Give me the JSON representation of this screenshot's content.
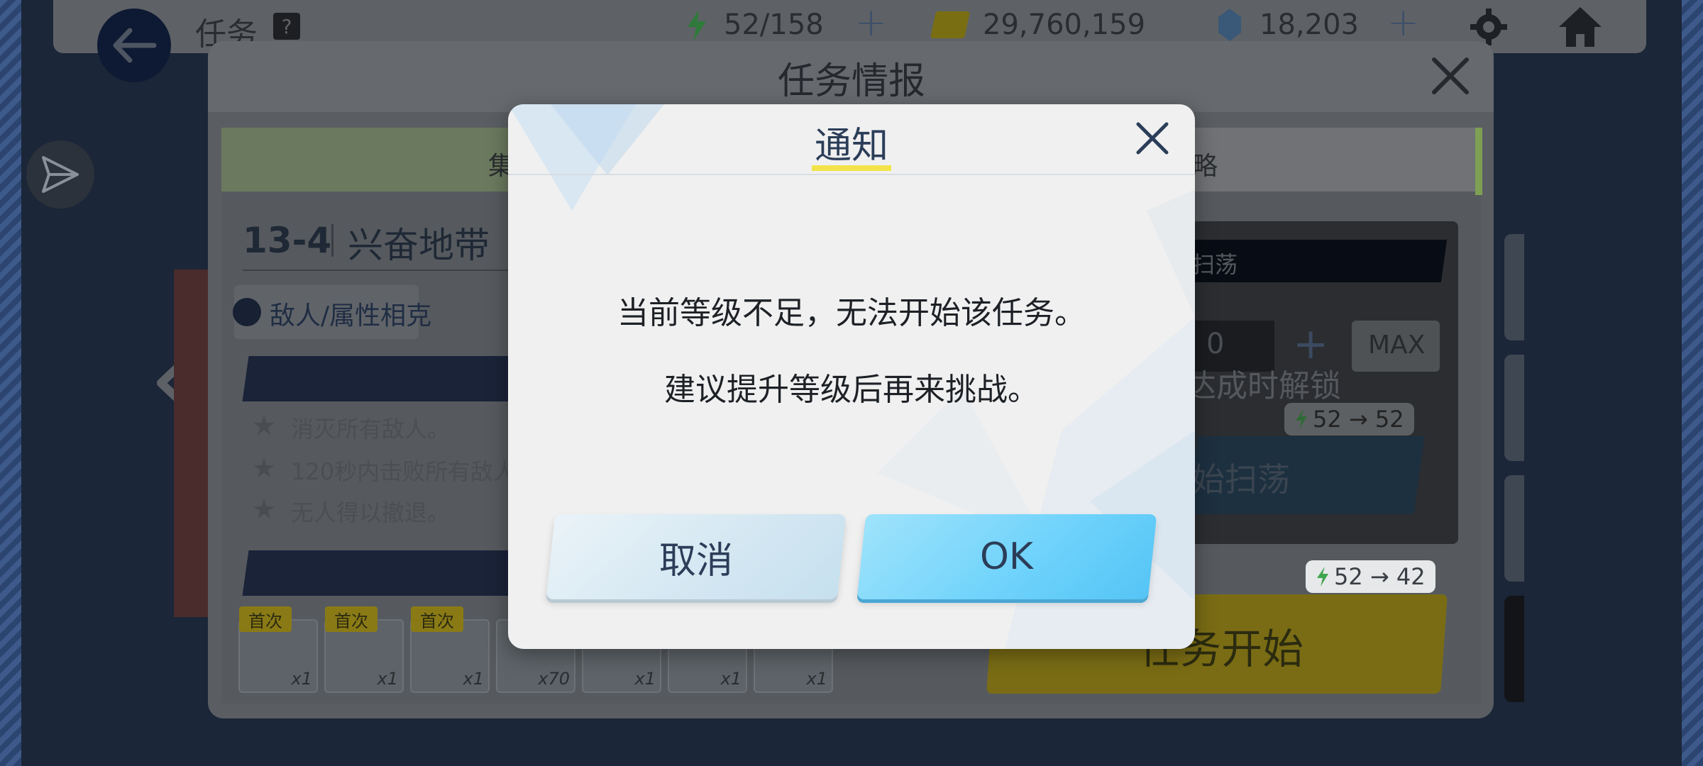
{
  "topbar": {
    "title": "任务",
    "help_badge": "?",
    "ap": "52/158",
    "credits": "29,760,159",
    "gems": "18,203"
  },
  "mission_panel": {
    "title": "任务情报",
    "tab_left_partial": "集",
    "tab_right_partial": "略",
    "stage_code": "13-4",
    "stage_name": "兴奋地带",
    "enemy_info_button": "敌人/属性相克",
    "conditions": [
      "消灭所有敌人。",
      "120秒内击败所有敌人",
      "无人得以撤退。"
    ],
    "first_clear_badge": "首次",
    "rewards": [
      {
        "qty": "x1",
        "first": true
      },
      {
        "qty": "x1",
        "first": true
      },
      {
        "qty": "x1",
        "first": true
      },
      {
        "qty": "x70",
        "first": false
      },
      {
        "qty": "x1",
        "first": false
      },
      {
        "qty": "x1",
        "first": false
      },
      {
        "qty": "x1",
        "first": false
      }
    ],
    "sweep": {
      "header_partial": "扫荡",
      "count": "0",
      "max_label": "MAX",
      "lock_text_partial": "达成时解锁",
      "ap_change": "52 → 52",
      "button_partial": "始扫荡"
    },
    "start": {
      "ap_change": "52 → 42",
      "button_partial": "任务开始"
    }
  },
  "dialog": {
    "title": "通知",
    "line1": "当前等级不足，无法开始该任务。",
    "line2": "建议提升等级后再来挑战。",
    "cancel_label": "取消",
    "ok_label": "OK"
  },
  "colors": {
    "dialog_title_underline": "#f3e34a",
    "ok_button": "#6dd2fb",
    "cancel_button": "#d3e7f2",
    "title_text": "#2b3d58"
  }
}
